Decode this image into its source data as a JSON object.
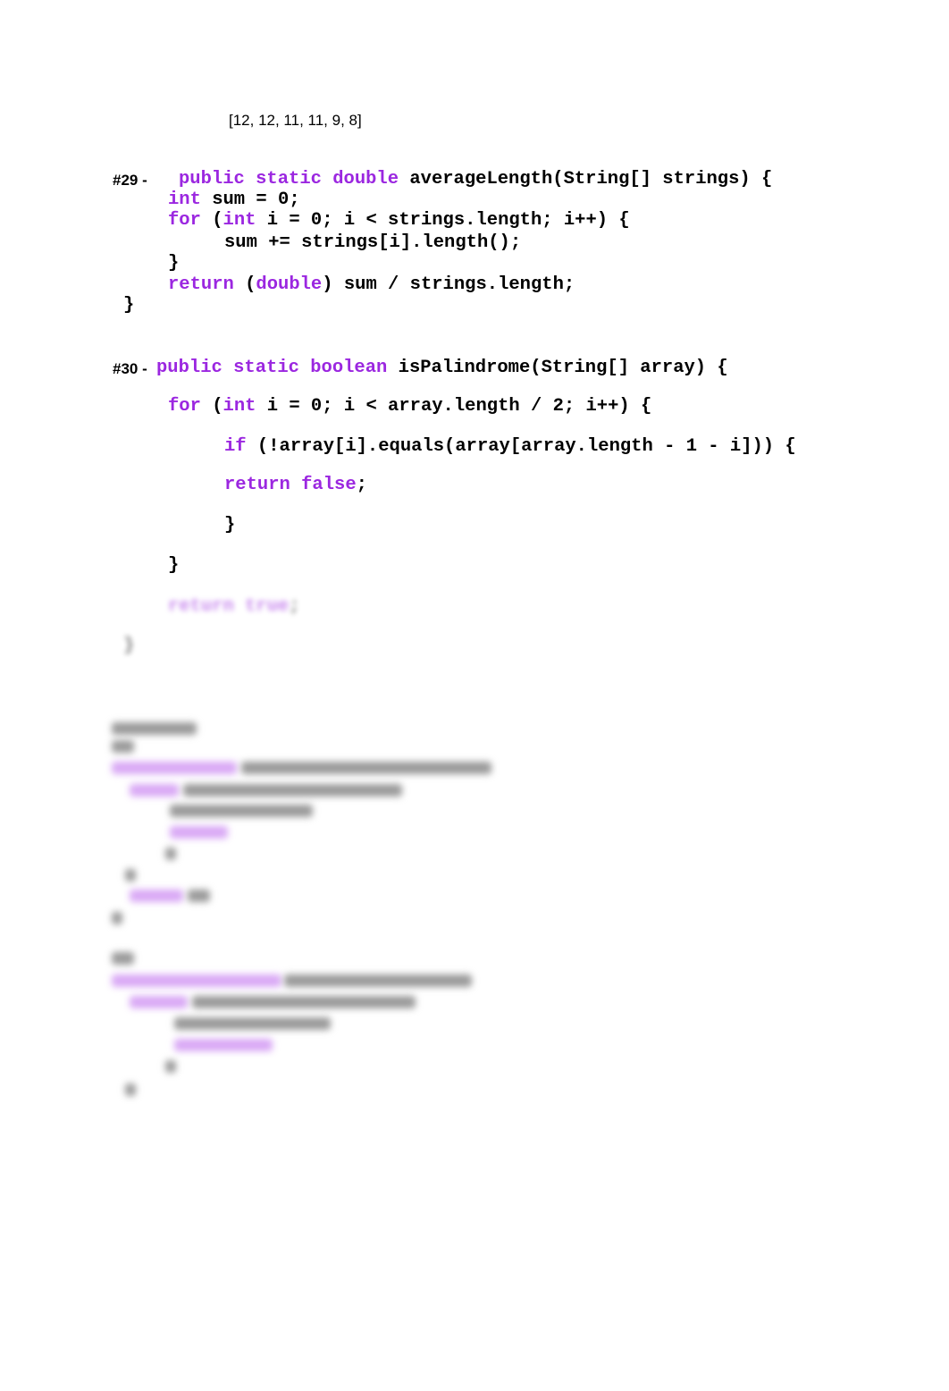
{
  "output_array": "[12, 12, 11, 11, 9, 8]",
  "q29": {
    "label": "#29 -",
    "lines": [
      [
        [
          "public static double ",
          "kw"
        ],
        [
          "averageLength(String[] strings) {",
          ""
        ]
      ],
      [
        [
          "int",
          "kw"
        ],
        [
          " sum = 0;",
          ""
        ]
      ],
      [
        [
          "for",
          "kw"
        ],
        [
          " (",
          ""
        ],
        [
          "int",
          "kw"
        ],
        [
          " i = 0; i < strings.length; i++) {",
          ""
        ]
      ],
      [
        [
          "sum += strings[i].length();",
          ""
        ]
      ],
      [
        [
          "}",
          ""
        ]
      ],
      [
        [
          "return",
          "kw"
        ],
        [
          " (",
          ""
        ],
        [
          "double",
          "kw"
        ],
        [
          ") sum / strings.length;",
          ""
        ]
      ],
      [
        [
          "}",
          ""
        ]
      ]
    ]
  },
  "q30": {
    "label": "#30 -",
    "lines": [
      [
        [
          "public static boolean ",
          "kw"
        ],
        [
          "isPalindrome(String[] array) {",
          ""
        ]
      ],
      [
        [
          "for",
          "kw"
        ],
        [
          " (",
          ""
        ],
        [
          "int",
          "kw"
        ],
        [
          " i = 0; i < array.length / 2; i++) {",
          ""
        ]
      ],
      [
        [
          "if",
          "kw"
        ],
        [
          " (!array[i].equals(array[array.length - 1 - i])) {",
          ""
        ]
      ],
      [
        [
          "return false",
          "kw"
        ],
        [
          ";",
          ""
        ]
      ],
      [
        [
          "}",
          ""
        ]
      ],
      [
        [
          "}",
          ""
        ]
      ],
      [
        [
          "return true",
          "kw"
        ],
        [
          ";",
          ""
        ]
      ],
      [
        [
          "}",
          ""
        ]
      ]
    ]
  },
  "colors": {
    "keyword": "#9b27e0",
    "text": "#000000"
  }
}
